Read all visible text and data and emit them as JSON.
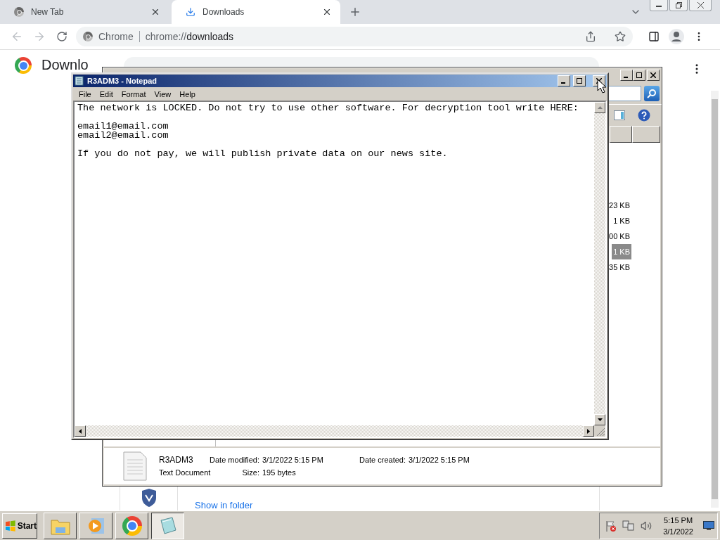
{
  "browser": {
    "tabs": [
      {
        "label": "New Tab",
        "selected": false,
        "kind": "newtab"
      },
      {
        "label": "Downloads",
        "selected": true,
        "kind": "download"
      }
    ],
    "address": {
      "site": "Chrome",
      "scheme": "chrome://",
      "path": "downloads"
    },
    "page_title": "Downlo",
    "download": {
      "link": "Show in folder"
    }
  },
  "explorer": {
    "sizes": [
      {
        "text": "23 KB",
        "selected": false
      },
      {
        "text": "1 KB",
        "selected": false
      },
      {
        "text": "00 KB",
        "selected": false
      },
      {
        "text": "1 KB",
        "selected": true
      },
      {
        "text": "35 KB",
        "selected": false
      }
    ],
    "details": {
      "name": "R3ADM3",
      "type": "Text Document",
      "modified_label": "Date modified:",
      "modified": "3/1/2022 5:15 PM",
      "created_label": "Date created:",
      "created": "3/1/2022 5:15 PM",
      "size_label": "Size:",
      "size": "195 bytes"
    }
  },
  "notepad": {
    "title": "R3ADM3 - Notepad",
    "menu": [
      "File",
      "Edit",
      "Format",
      "View",
      "Help"
    ],
    "paragraphs": [
      [
        "The network is LOCKED. Do not try to use other software. For decryption tool write HERE:"
      ],
      [
        "email1@email.com",
        "email2@email.com"
      ],
      [
        "If you do not pay, we will publish private data on our news site."
      ]
    ]
  },
  "taskbar": {
    "start": "Start",
    "apps": [
      {
        "kind": "folder",
        "selected": false
      },
      {
        "kind": "media",
        "selected": false
      },
      {
        "kind": "chrome",
        "selected": false
      },
      {
        "kind": "notepad",
        "selected": true
      }
    ],
    "time": "5:15 PM",
    "date": "3/1/2022"
  }
}
